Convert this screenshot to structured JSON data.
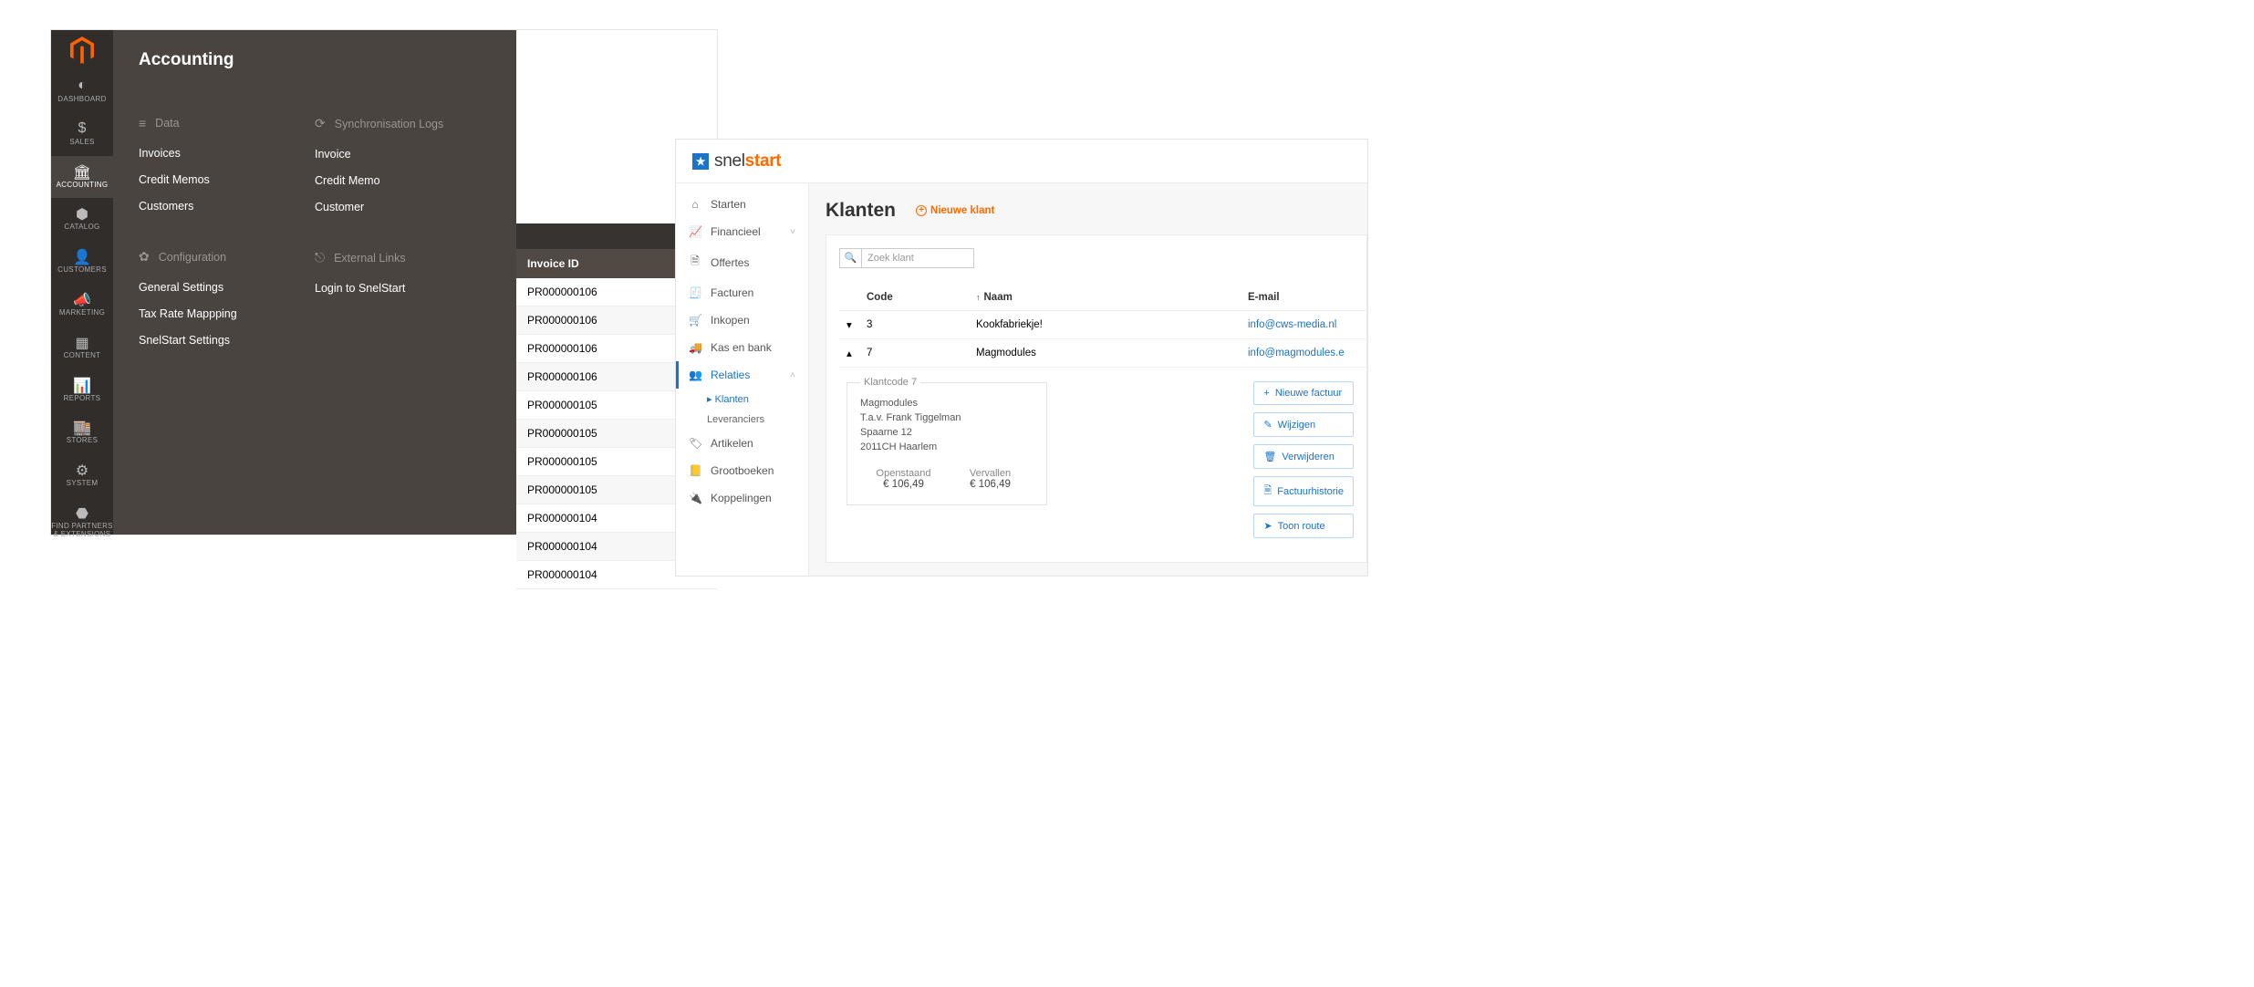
{
  "magento": {
    "flyout_title": "Accounting",
    "rail": [
      {
        "name": "dashboard",
        "label": "DASHBOARD",
        "icon": "◐"
      },
      {
        "name": "sales",
        "label": "SALES",
        "icon": "$"
      },
      {
        "name": "accounting",
        "label": "ACCOUNTING",
        "icon": "🏛"
      },
      {
        "name": "catalog",
        "label": "CATALOG",
        "icon": "⬢"
      },
      {
        "name": "customers",
        "label": "CUSTOMERS",
        "icon": "👤"
      },
      {
        "name": "marketing",
        "label": "MARKETING",
        "icon": "📣"
      },
      {
        "name": "content",
        "label": "CONTENT",
        "icon": "▦"
      },
      {
        "name": "reports",
        "label": "REPORTS",
        "icon": "📊"
      },
      {
        "name": "stores",
        "label": "STORES",
        "icon": "🏬"
      },
      {
        "name": "system",
        "label": "SYSTEM",
        "icon": "⚙"
      },
      {
        "name": "partners",
        "label": "FIND PARTNERS & EXTENSIONS",
        "icon": "⬣"
      }
    ],
    "groups": {
      "data": {
        "title": "Data",
        "icon": "≡",
        "links": [
          "Invoices",
          "Credit Memos",
          "Customers"
        ]
      },
      "sync": {
        "title": "Synchronisation Logs",
        "icon": "⟳",
        "links": [
          "Invoice",
          "Credit Memo",
          "Customer"
        ]
      },
      "config": {
        "title": "Configuration",
        "icon": "✿",
        "links": [
          "General Settings",
          "Tax Rate Mappping",
          "SnelStart Settings"
        ]
      },
      "ext": {
        "title": "External Links",
        "icon": "⎋",
        "links": [
          "Login to SnelStart"
        ]
      }
    },
    "table": {
      "header": "Invoice ID",
      "rows": [
        "PR000000106",
        "PR000000106",
        "PR000000106",
        "PR000000106",
        "PR000000105",
        "PR000000105",
        "PR000000105",
        "PR000000105",
        "PR000000104",
        "PR000000104",
        "PR000000104"
      ]
    }
  },
  "snelstart": {
    "logo_part1": "snel",
    "logo_part2": "start",
    "nav": [
      {
        "name": "starten",
        "label": "Starten",
        "icon": "⌂"
      },
      {
        "name": "financieel",
        "label": "Financieel",
        "icon": "📈",
        "expand": true
      },
      {
        "name": "offertes",
        "label": "Offertes",
        "icon": "🗎"
      },
      {
        "name": "facturen",
        "label": "Facturen",
        "icon": "🧾"
      },
      {
        "name": "inkopen",
        "label": "Inkopen",
        "icon": "🛒"
      },
      {
        "name": "kasbank",
        "label": "Kas en bank",
        "icon": "🚚"
      },
      {
        "name": "relaties",
        "label": "Relaties",
        "icon": "👥",
        "active": true,
        "sub": [
          {
            "label": "Klanten",
            "sel": true
          },
          {
            "label": "Leveranciers"
          }
        ]
      },
      {
        "name": "artikelen",
        "label": "Artikelen",
        "icon": "🏷"
      },
      {
        "name": "grootboeken",
        "label": "Grootboeken",
        "icon": "📒"
      },
      {
        "name": "koppelingen",
        "label": "Koppelingen",
        "icon": "🔌"
      }
    ],
    "title": "Klanten",
    "new_label": "Nieuwe klant",
    "search_placeholder": "Zoek klant",
    "cols": {
      "code": "Code",
      "name": "Naam",
      "mail": "E-mail"
    },
    "rows": [
      {
        "exp": "▾",
        "code": "3",
        "name": "Kookfabriekje!",
        "mail": "info@cws-media.nl"
      },
      {
        "exp": "▴",
        "code": "7",
        "name": "Magmodules",
        "mail": "info@magmodules.e"
      }
    ],
    "detail": {
      "legend": "Klantcode 7",
      "lines": [
        "Magmodules",
        "T.a.v. Frank Tiggelman",
        "Spaarne 12",
        "2011CH Haarlem"
      ],
      "open_label": "Openstaand",
      "open_val": "€ 106,49",
      "due_label": "Vervallen",
      "due_val": "€ 106,49"
    },
    "actions": [
      {
        "icon": "+",
        "label": "Nieuwe factuur"
      },
      {
        "icon": "✎",
        "label": "Wijzigen"
      },
      {
        "icon": "🗑",
        "label": "Verwijderen"
      },
      {
        "icon": "🗎",
        "label": "Factuurhistorie"
      },
      {
        "icon": "➤",
        "label": "Toon route"
      }
    ]
  }
}
